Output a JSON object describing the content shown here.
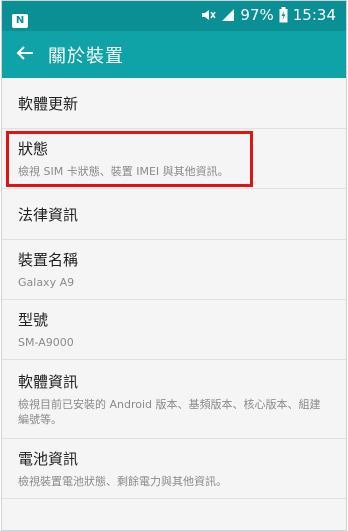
{
  "status_bar": {
    "notification_icon": "N",
    "battery_percent": "97%",
    "time": "15:34"
  },
  "app_bar": {
    "title": "關於裝置"
  },
  "items": [
    {
      "title": "軟體更新",
      "subtitle": ""
    },
    {
      "title": "狀態",
      "subtitle": "檢視 SIM 卡狀態、裝置 IMEI 與其他資訊。"
    },
    {
      "title": "法律資訊",
      "subtitle": ""
    },
    {
      "title": "裝置名稱",
      "subtitle": "Galaxy A9"
    },
    {
      "title": "型號",
      "subtitle": "SM-A9000"
    },
    {
      "title": "軟體資訊",
      "subtitle": "檢視目前已安裝的 Android 版本、基頻版本、核心版本、組建編號等。"
    },
    {
      "title": "電池資訊",
      "subtitle": "檢視裝置電池狀態、剩餘電力與其他資訊。"
    }
  ],
  "colors": {
    "status_bar": "#0a8f95",
    "app_bar": "#0fa2a7",
    "highlight": "#e01414"
  }
}
